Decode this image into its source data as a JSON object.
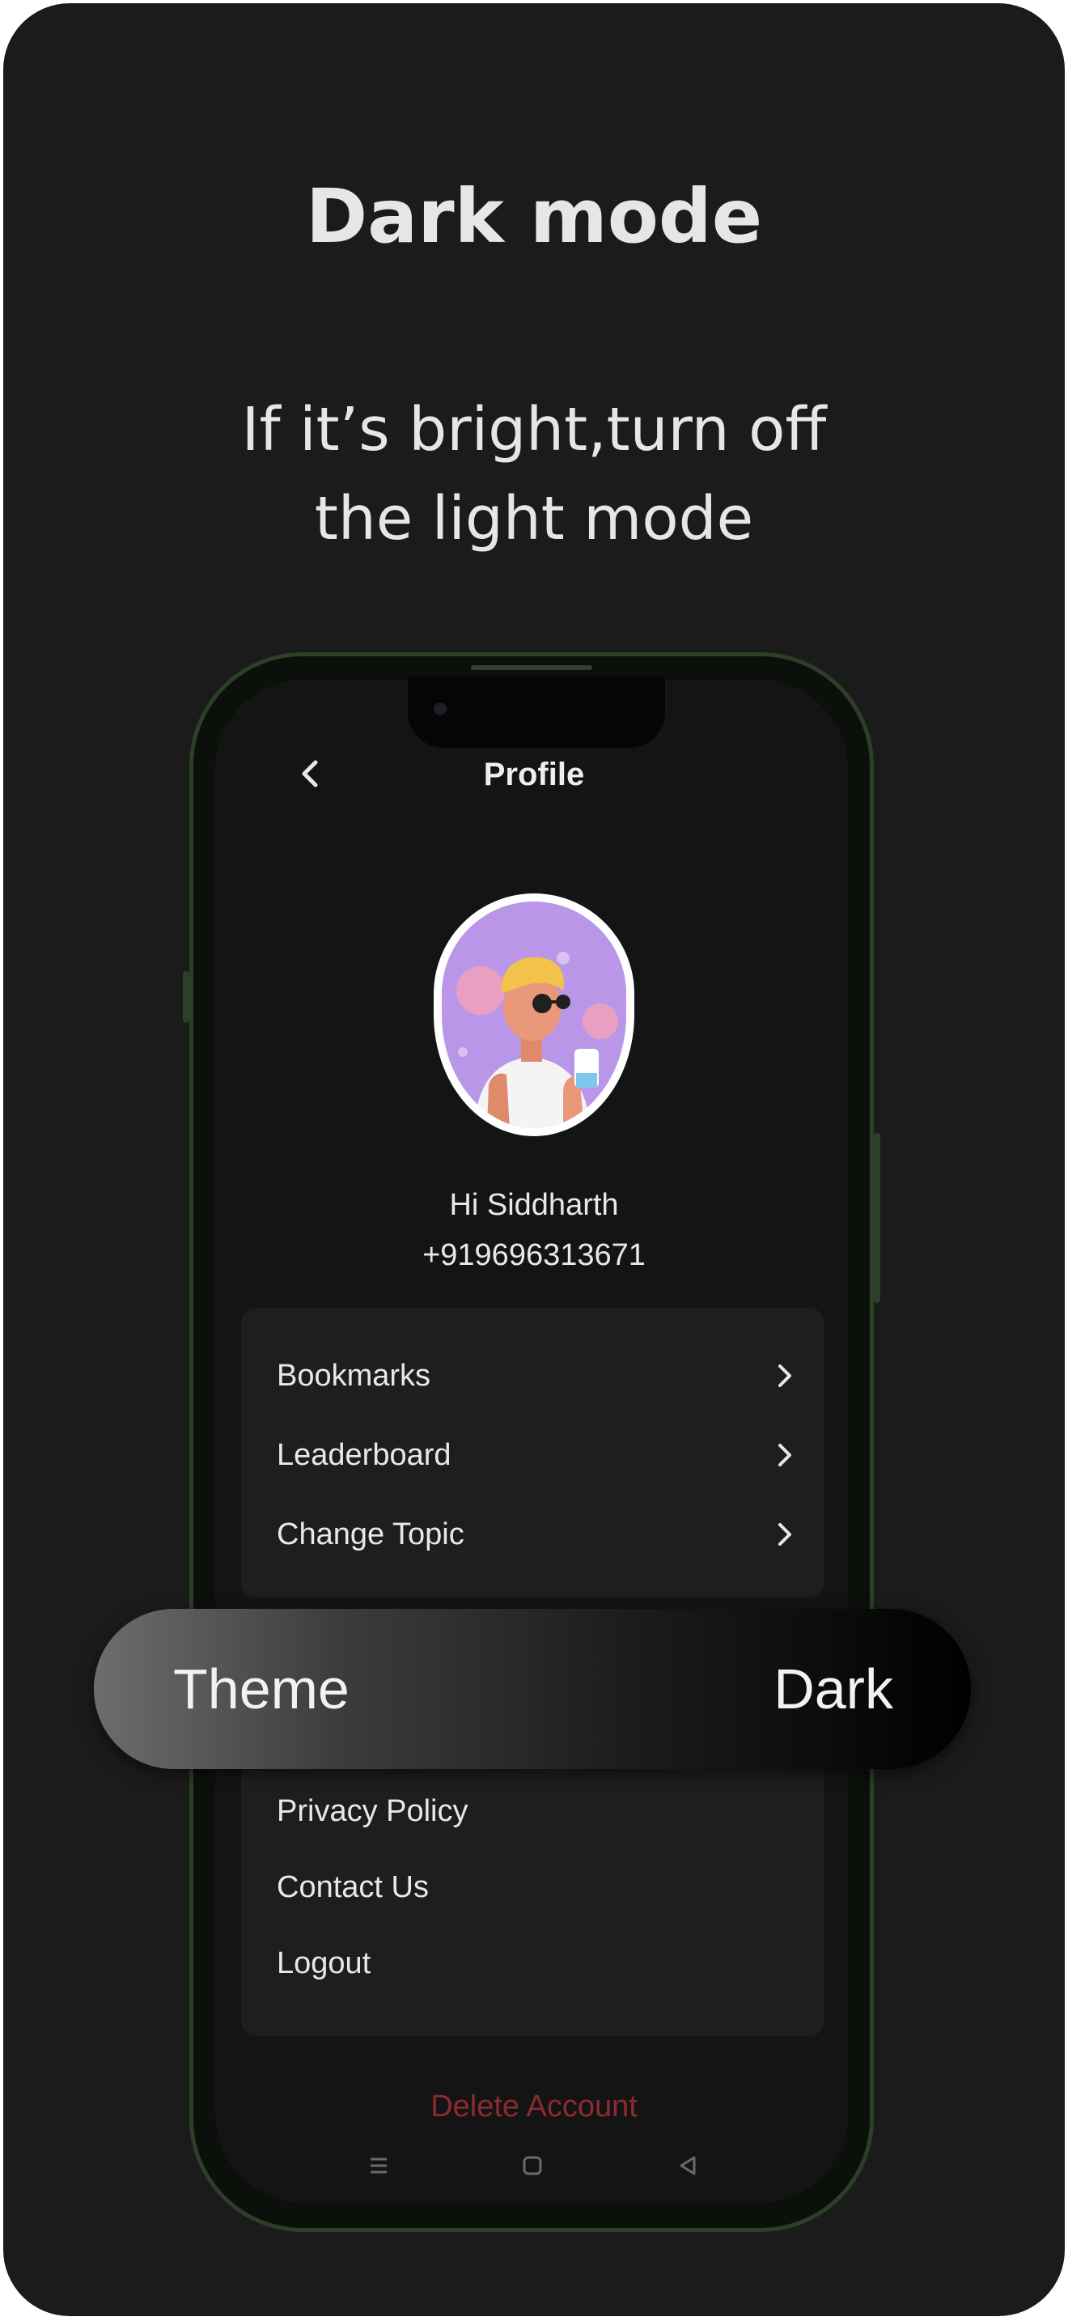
{
  "headline": "Dark mode",
  "subheadline": {
    "line1": "If it’s bright,turn off",
    "line2": "the light mode"
  },
  "screen": {
    "title": "Profile",
    "back_icon": "chevron-left-icon",
    "user": {
      "greeting": "Hi Siddharth",
      "phone": "+919696313671"
    },
    "menu_primary": [
      {
        "label": "Bookmarks",
        "icon": "chevron-right-icon"
      },
      {
        "label": "Leaderboard",
        "icon": "chevron-right-icon"
      },
      {
        "label": "Change Topic",
        "icon": "chevron-right-icon"
      }
    ],
    "theme": {
      "label": "Theme",
      "value": "Dark"
    },
    "menu_secondary": [
      {
        "label": "Privacy Policy"
      },
      {
        "label": "Contact Us"
      },
      {
        "label": "Logout"
      }
    ],
    "delete_account": "Delete Account",
    "nav_icons": [
      "menu-icon",
      "home-square-icon",
      "back-triangle-icon"
    ]
  },
  "colors": {
    "background": "#1b1b1b",
    "phone_border": "#2c3f27",
    "delete_text": "#8a2b30",
    "avatar_bg": "#b996e8"
  }
}
